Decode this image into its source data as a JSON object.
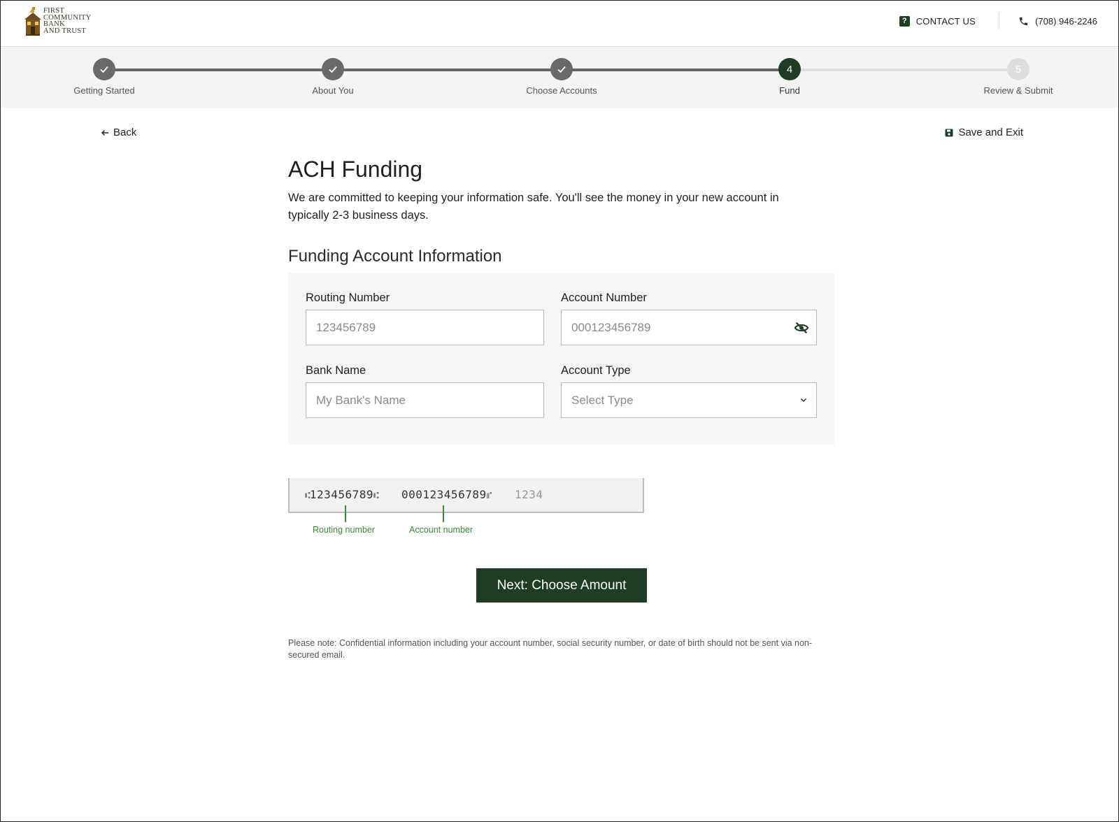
{
  "brand": {
    "logo_lines": [
      "FIRST",
      "COMMUNITY",
      "BANK",
      "AND TRUST"
    ],
    "accent_color": "#1e3d23"
  },
  "header": {
    "contact_label": "CONTACT US",
    "contact_icon": "question-icon",
    "phone_label": "(708) 946-2246",
    "phone_icon": "phone-icon"
  },
  "stepper": {
    "steps": [
      {
        "label": "Getting Started",
        "state": "done"
      },
      {
        "label": "About You",
        "state": "done"
      },
      {
        "label": "Choose Accounts",
        "state": "done"
      },
      {
        "label": "Fund",
        "state": "current",
        "number": "4"
      },
      {
        "label": "Review & Submit",
        "state": "future",
        "number": "5"
      }
    ]
  },
  "nav": {
    "back_label": "Back",
    "save_label": "Save and Exit"
  },
  "page": {
    "title": "ACH Funding",
    "intro": "We are committed to keeping your information safe. You'll see the money in your new account in typically 2-3 business days.",
    "section_title": "Funding Account Information"
  },
  "form": {
    "routing": {
      "label": "Routing Number",
      "placeholder": "123456789"
    },
    "account": {
      "label": "Account Number",
      "placeholder": "000123456789"
    },
    "bank": {
      "label": "Bank Name",
      "placeholder": "My Bank's Name"
    },
    "type": {
      "label": "Account Type",
      "placeholder": "Select Type"
    }
  },
  "check_sample": {
    "routing": "123456789",
    "account": "000123456789",
    "check_number": "1234",
    "routing_caption": "Routing number",
    "account_caption": "Account number"
  },
  "actions": {
    "next_label": "Next: Choose Amount"
  },
  "footer": {
    "note": "Please note: Confidential information including your account number, social security number, or date of birth should not be sent via non-secured email."
  }
}
